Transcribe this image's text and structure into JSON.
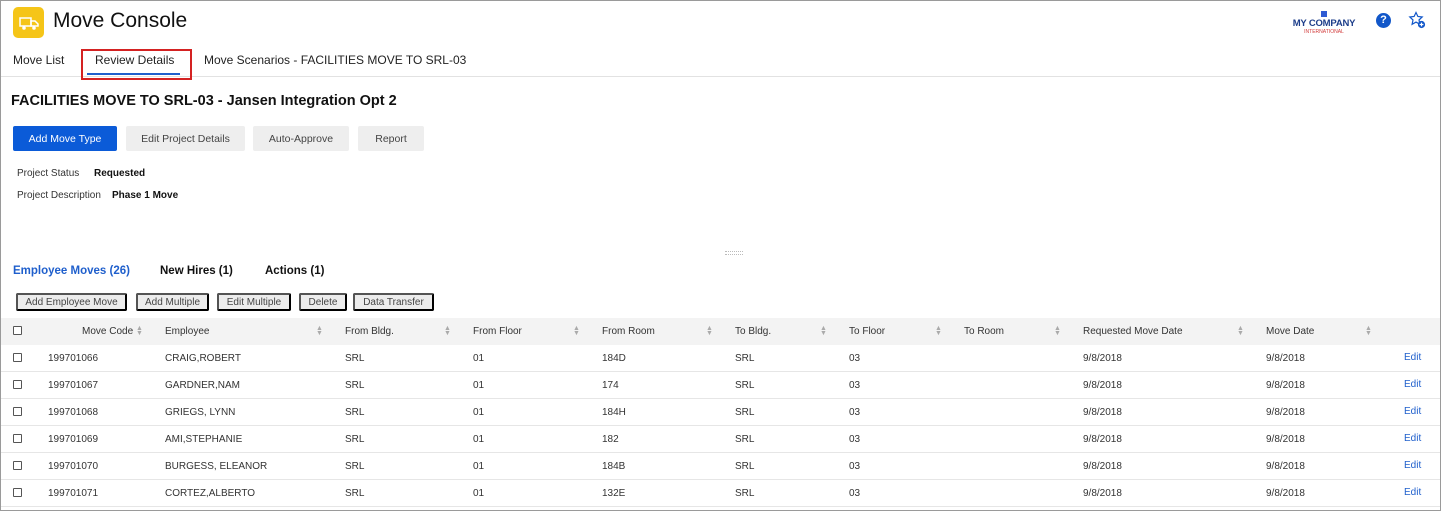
{
  "header": {
    "app_title": "Move Console",
    "logo_line1": "MY COMPANY",
    "logo_line2": "INTERNATIONAL",
    "help_glyph": "?"
  },
  "nav": {
    "tabs": [
      {
        "label": "Move List"
      },
      {
        "label": "Review Details",
        "active": true
      },
      {
        "label": "Move Scenarios - FACILITIES MOVE TO SRL-03"
      }
    ]
  },
  "page": {
    "title": "FACILITIES MOVE TO SRL-03 - Jansen Integration Opt 2",
    "actions": [
      "Add Move Type",
      "Edit Project Details",
      "Auto-Approve",
      "Report"
    ],
    "fields": [
      {
        "label": "Project Status",
        "value": "Requested"
      },
      {
        "label": "Project Description",
        "value": "Phase 1 Move"
      }
    ]
  },
  "subtabs": [
    {
      "label": "Employee Moves (26)",
      "active": true
    },
    {
      "label": "New Hires (1)"
    },
    {
      "label": "Actions (1)"
    }
  ],
  "table_actions": [
    "Add Employee Move",
    "Add Multiple",
    "Edit Multiple",
    "Delete",
    "Data Transfer"
  ],
  "table": {
    "columns": [
      "Move Code",
      "Employee",
      "From Bldg.",
      "From Floor",
      "From Room",
      "To Bldg.",
      "To Floor",
      "To Room",
      "Requested Move Date",
      "Move Date"
    ],
    "edit_label": "Edit",
    "rows": [
      [
        "199701066",
        "CRAIG,ROBERT",
        "SRL",
        "01",
        "184D",
        "SRL",
        "03",
        "",
        "9/8/2018",
        "9/8/2018"
      ],
      [
        "199701067",
        "GARDNER,NAM",
        "SRL",
        "01",
        "174",
        "SRL",
        "03",
        "",
        "9/8/2018",
        "9/8/2018"
      ],
      [
        "199701068",
        "GRIEGS, LYNN",
        "SRL",
        "01",
        "184H",
        "SRL",
        "03",
        "",
        "9/8/2018",
        "9/8/2018"
      ],
      [
        "199701069",
        "AMI,STEPHANIE",
        "SRL",
        "01",
        "182",
        "SRL",
        "03",
        "",
        "9/8/2018",
        "9/8/2018"
      ],
      [
        "199701070",
        "BURGESS, ELEANOR",
        "SRL",
        "01",
        "184B",
        "SRL",
        "03",
        "",
        "9/8/2018",
        "9/8/2018"
      ],
      [
        "199701071",
        "CORTEZ,ALBERTO",
        "SRL",
        "01",
        "132E",
        "SRL",
        "03",
        "",
        "9/8/2018",
        "9/8/2018"
      ]
    ]
  },
  "colors": {
    "accent": "#0b5bd8",
    "tab_link": "#1f5fcc",
    "highlight_box": "#d42222",
    "app_icon": "#f5c518"
  },
  "icons": {
    "app": "truck-icon",
    "help": "help-icon",
    "favorites": "star-plus-icon",
    "sort": "sort-icon"
  }
}
